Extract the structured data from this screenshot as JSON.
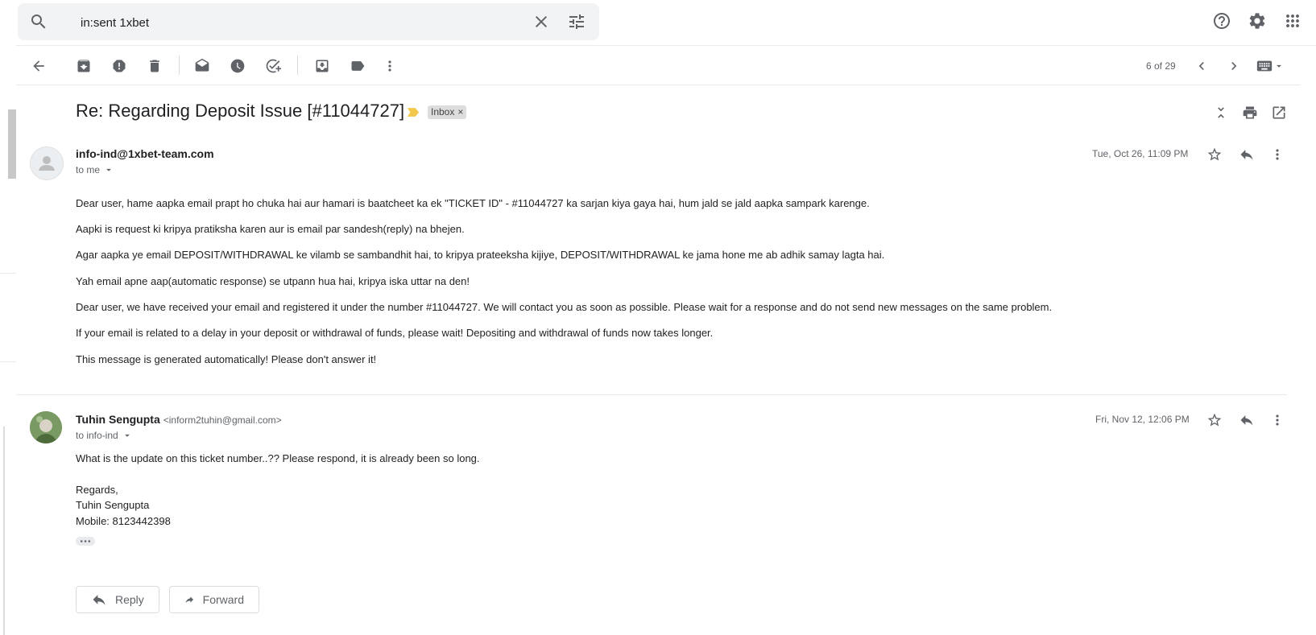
{
  "search": {
    "query": "in:sent 1xbet"
  },
  "toolbar": {
    "pagination": "6 of 29"
  },
  "thread": {
    "subject": "Re: Regarding Deposit Issue [#11044727]",
    "label_chip": "Inbox",
    "label_chip_close": "×"
  },
  "messages": [
    {
      "sender_name": "info-ind@1xbet-team.com",
      "to": "to me",
      "date": "Tue, Oct 26, 11:09 PM",
      "body": [
        "Dear user, hame aapka email prapt ho chuka hai aur hamari is baatcheet ka ek \"TICKET ID\" - #11044727 ka sarjan kiya gaya hai, hum jald se jald aapka sampark karenge.",
        "Aapki is request ki kripya pratiksha karen aur is email par sandesh(reply) na bhejen.",
        "Agar aapka ye email DEPOSIT/WITHDRAWAL ke vilamb se sambandhit hai, to kripya prateeksha kijiye, DEPOSIT/WITHDRAWAL ke jama hone me ab adhik samay lagta hai.",
        "Yah email apne aap(automatic response) se utpann hua hai, kripya iska uttar na den!",
        "Dear user, we have received your email and registered it under the number #11044727. We will contact you as soon as possible. Please wait for a response and do not send new messages on the same problem.",
        "If your email is related to a delay in your deposit or withdrawal of funds, please wait! Depositing and withdrawal of funds now takes longer.",
        "This message is generated automatically! Please don't answer it!"
      ]
    },
    {
      "sender_name": "Tuhin Sengupta",
      "sender_email": "<inform2tuhin@gmail.com>",
      "to": "to info-ind",
      "date": "Fri, Nov 12, 12:06 PM",
      "body": [
        "What is the update on this ticket number..?? Please respond, it is already been so long."
      ],
      "signature": [
        "Regards,",
        "Tuhin Sengupta",
        "Mobile: 8123442398"
      ]
    }
  ],
  "actions": {
    "reply": "Reply",
    "forward": "Forward"
  },
  "colors": {
    "important_marker": "#f2c94c",
    "chip_bg": "#dddddd"
  }
}
